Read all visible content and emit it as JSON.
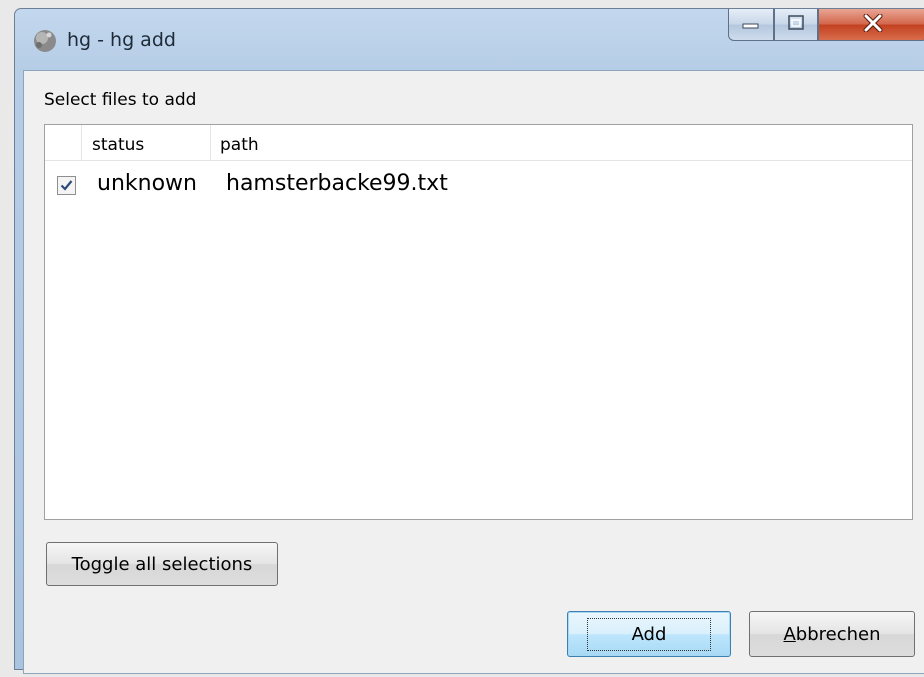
{
  "window": {
    "title": "hg - hg add",
    "controls": {
      "minimize": "minimize",
      "maximize": "maximize",
      "close": "close"
    }
  },
  "main": {
    "instruction": "Select files to add",
    "columns": [
      {
        "label": "status"
      },
      {
        "label": "path"
      }
    ],
    "rows": [
      {
        "checked": true,
        "status": "unknown",
        "path": "hamsterbacke99.txt"
      }
    ]
  },
  "buttons": {
    "toggle_label": "Toggle all selections",
    "add_label": "Add",
    "cancel_label": "Abbrechen",
    "cancel_accel_char": "A",
    "cancel_rest": "bbrechen"
  },
  "icons": {
    "app": "hg-app-icon",
    "minimize": "minimize-icon",
    "maximize": "maximize-icon",
    "close": "close-icon",
    "checkmark": "checkmark-icon"
  },
  "colors": {
    "titlebar": "#b6cde6",
    "close_button": "#c2401f",
    "default_button_border": "#3c7fb1",
    "dialog_background": "#f0f0f0"
  }
}
